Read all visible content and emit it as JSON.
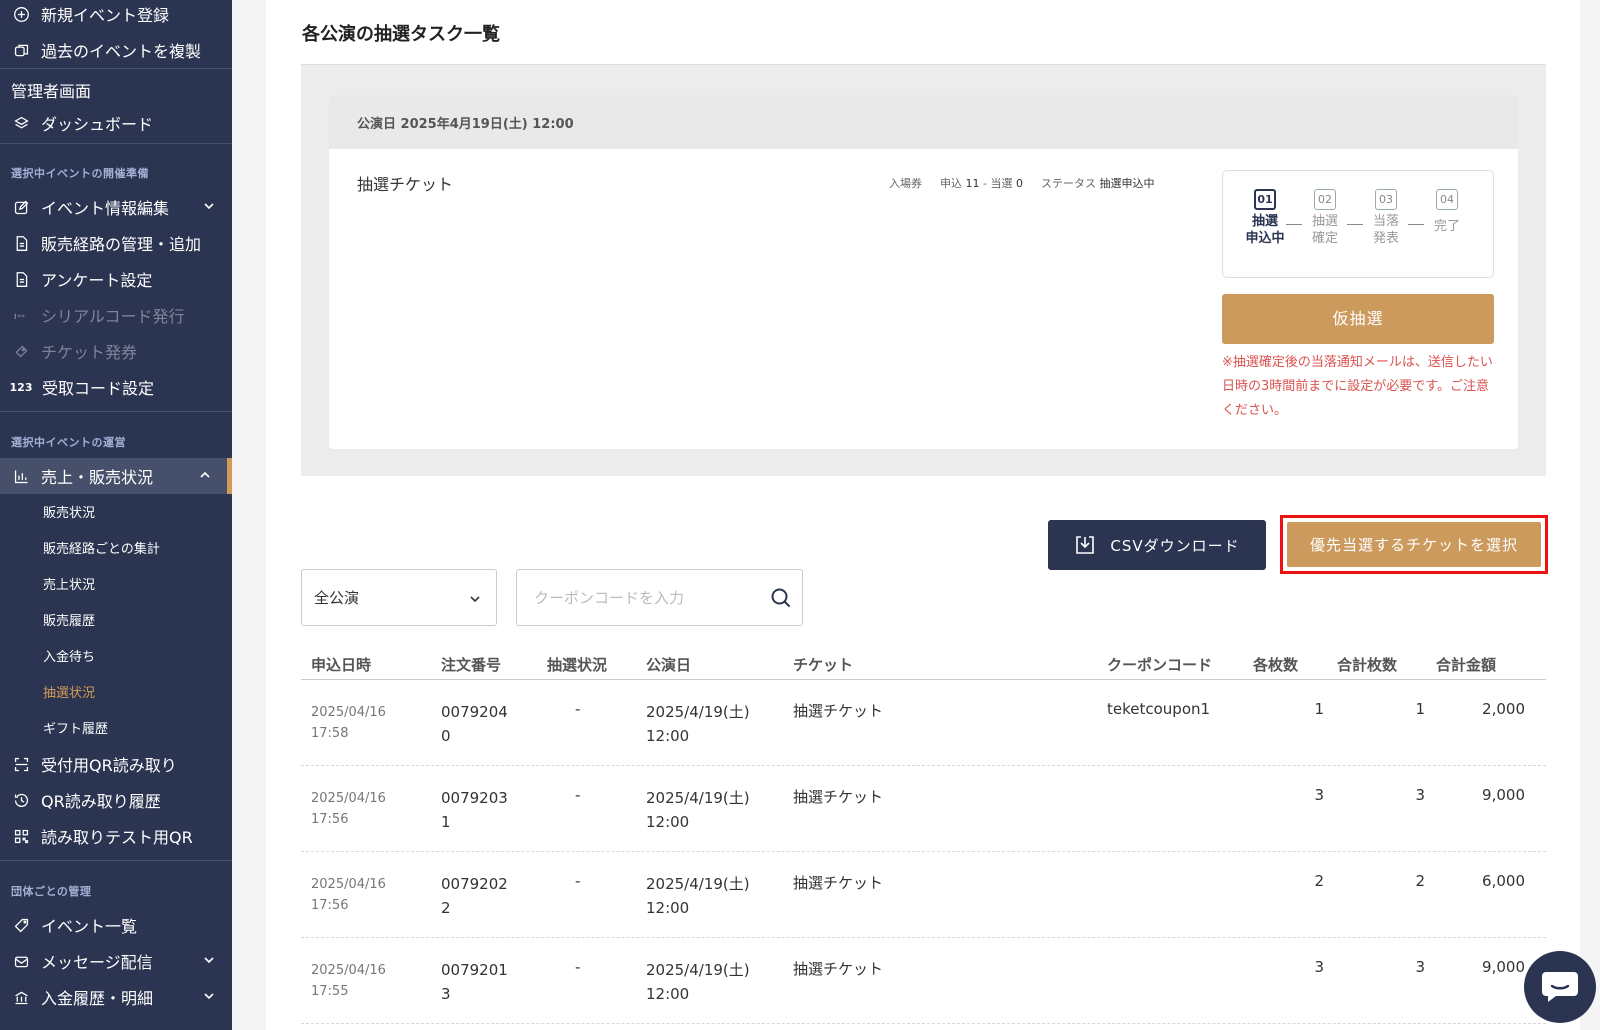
{
  "sidebar": {
    "top_items": [
      {
        "label": "新規イベント登録",
        "icon": "plus-circle-icon"
      },
      {
        "label": "過去のイベントを複製",
        "icon": "copy-icon"
      }
    ],
    "admin_label": "管理者画面",
    "dashboard_label": "ダッシュボード",
    "section_prep": "選択中イベントの開催準備",
    "prep_items": [
      {
        "label": "イベント情報編集"
      },
      {
        "label": "販売経路の管理・追加"
      },
      {
        "label": "アンケート設定"
      },
      {
        "label": "シリアルコード発行"
      },
      {
        "label": "チケット発券"
      },
      {
        "label": "受取コード設定",
        "icon_text": "123"
      }
    ],
    "section_ops": "選択中イベントの運営",
    "sales_label": "売上・販売状況",
    "sales_subitems": [
      "販売状況",
      "販売経路ごとの集計",
      "売上状況",
      "販売履歴",
      "入金待ち",
      "抽選状況",
      "ギフト履歴"
    ],
    "ops_items": [
      {
        "label": "受付用QR読み取り"
      },
      {
        "label": "QR読み取り履歴"
      },
      {
        "label": "読み取りテスト用QR"
      }
    ],
    "section_group": "団体ごとの管理",
    "group_items": [
      {
        "label": "イベント一覧"
      },
      {
        "label": "メッセージ配信"
      },
      {
        "label": "入金履歴・明細"
      }
    ]
  },
  "main": {
    "title": "各公演の抽選タスク一覧",
    "performance_date": "公演日 2025年4月19日(土) 12:00",
    "ticket_name": "抽選チケット",
    "meta": {
      "type": "入場券",
      "apply_label": "申込",
      "apply_count": "11",
      "separator": "-",
      "win_label": "当選",
      "win_count": "0",
      "status_label": "ステータス",
      "status_value": "抽選申込中"
    },
    "steps": [
      {
        "num": "01",
        "line1": "抽選",
        "line2": "申込中"
      },
      {
        "num": "02",
        "line1": "抽選",
        "line2": "確定"
      },
      {
        "num": "03",
        "line1": "当落",
        "line2": "発表"
      },
      {
        "num": "04",
        "line1": "完了",
        "line2": ""
      }
    ],
    "draw_button": "仮抽選",
    "draw_note": "※抽選確定後の当落通知メールは、送信したい日時の3時間前までに設定が必要です。ご注意ください。",
    "csv_button": "CSVダウンロード",
    "priority_button": "優先当選するチケットを選択",
    "filter_select": "全公演",
    "coupon_placeholder": "クーポンコードを入力",
    "table": {
      "headers": [
        "申込日時",
        "注文番号",
        "抽選状況",
        "公演日",
        "チケット",
        "クーポンコード",
        "各枚数",
        "合計枚数",
        "合計金額"
      ],
      "rows": [
        {
          "date1": "2025/04/16",
          "date2": "17:58",
          "order1": "0079204",
          "order2": "0",
          "status": "-",
          "perf1": "2025/4/19(土)",
          "perf2": "12:00",
          "ticket": "抽選チケット",
          "coupon": "teketcoupon1",
          "each": "1",
          "total": "1",
          "amount": "2,000"
        },
        {
          "date1": "2025/04/16",
          "date2": "17:56",
          "order1": "0079203",
          "order2": "1",
          "status": "-",
          "perf1": "2025/4/19(土)",
          "perf2": "12:00",
          "ticket": "抽選チケット",
          "coupon": "",
          "each": "3",
          "total": "3",
          "amount": "9,000"
        },
        {
          "date1": "2025/04/16",
          "date2": "17:56",
          "order1": "0079202",
          "order2": "2",
          "status": "-",
          "perf1": "2025/4/19(土)",
          "perf2": "12:00",
          "ticket": "抽選チケット",
          "coupon": "",
          "each": "2",
          "total": "2",
          "amount": "6,000"
        },
        {
          "date1": "2025/04/16",
          "date2": "17:55",
          "order1": "0079201",
          "order2": "3",
          "status": "-",
          "perf1": "2025/4/19(土)",
          "perf2": "12:00",
          "ticket": "抽選チケット",
          "coupon": "",
          "each": "3",
          "total": "3",
          "amount": "9,000"
        }
      ]
    }
  },
  "colors": {
    "sidebar_bg": "#2b3450",
    "accent": "#cc9a5d",
    "highlight_border": "#ee1111",
    "note": "#d9534f"
  }
}
